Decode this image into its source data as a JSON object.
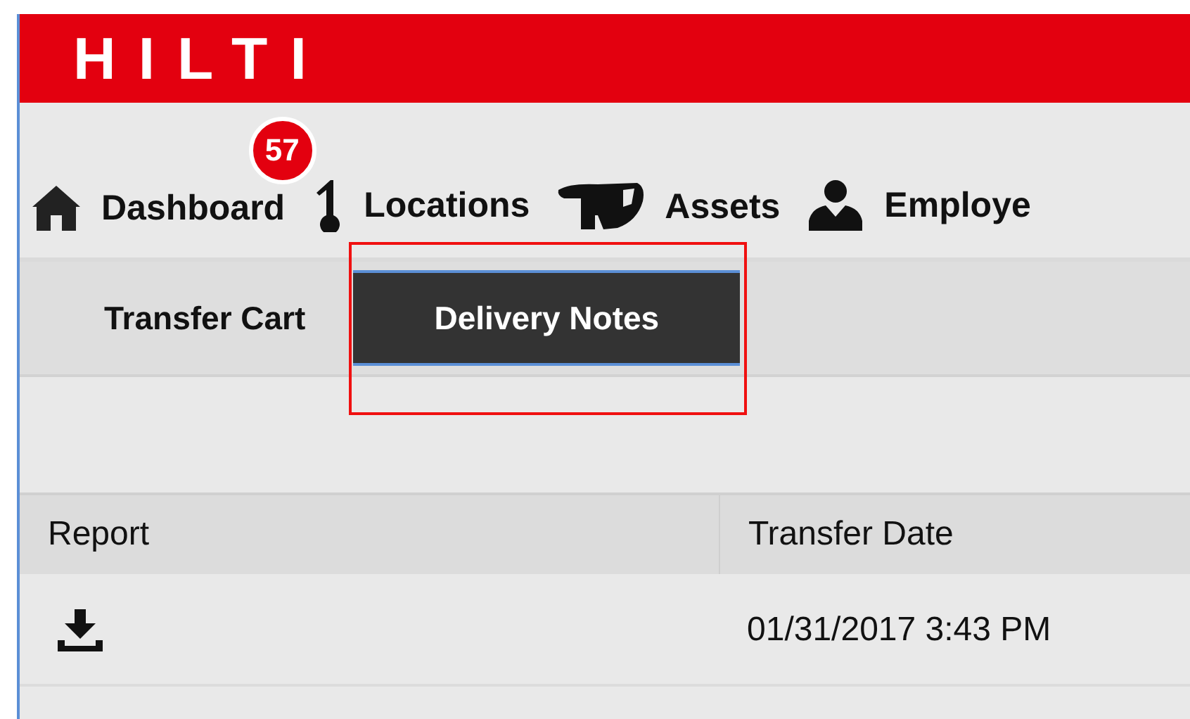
{
  "header": {
    "logo": "HILTI"
  },
  "nav": {
    "items": [
      {
        "label": "Dashboard",
        "badge": "57"
      },
      {
        "label": "Locations"
      },
      {
        "label": "Assets"
      },
      {
        "label": "Employe"
      }
    ]
  },
  "tabs": [
    {
      "label": "Transfer Cart",
      "selected": false,
      "highlighted": false
    },
    {
      "label": "Delivery Notes",
      "selected": true,
      "highlighted": true
    }
  ],
  "table": {
    "columns": [
      "Report",
      "Transfer Date"
    ],
    "rows": [
      {
        "transfer_date": "01/31/2017 3:43 PM"
      }
    ]
  }
}
